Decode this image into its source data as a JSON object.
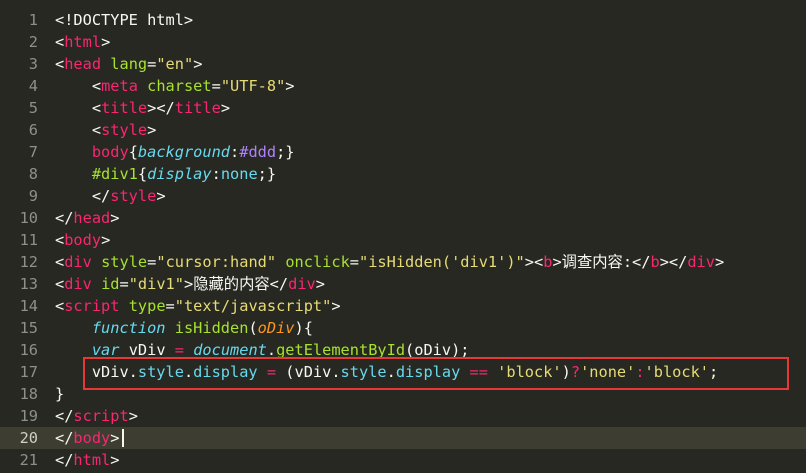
{
  "editor": {
    "theme_colors": {
      "background": "#272822",
      "tag": "#f92672",
      "attribute": "#a6e22e",
      "string": "#e6db74",
      "keyword": "#66d9ef",
      "number": "#ae81ff",
      "parameter": "#fd971f",
      "highlight_box": "#e53935"
    },
    "active_line": 20,
    "lines": [
      {
        "n": "1",
        "tokens": [
          [
            "p",
            "<!DOCTYPE html>"
          ]
        ]
      },
      {
        "n": "2",
        "tokens": [
          [
            "p",
            "<"
          ],
          [
            "t",
            "html"
          ],
          [
            "p",
            ">"
          ]
        ]
      },
      {
        "n": "3",
        "tokens": [
          [
            "p",
            "<"
          ],
          [
            "t",
            "head"
          ],
          [
            "p",
            " "
          ],
          [
            "a",
            "lang"
          ],
          [
            "p",
            "="
          ],
          [
            "s",
            "\"en\""
          ],
          [
            "p",
            ">"
          ]
        ]
      },
      {
        "n": "4",
        "tokens": [
          [
            "p",
            "    <"
          ],
          [
            "t",
            "meta"
          ],
          [
            "p",
            " "
          ],
          [
            "a",
            "charset"
          ],
          [
            "p",
            "="
          ],
          [
            "s",
            "\"UTF-8\""
          ],
          [
            "p",
            ">"
          ]
        ]
      },
      {
        "n": "5",
        "tokens": [
          [
            "p",
            "    <"
          ],
          [
            "t",
            "title"
          ],
          [
            "p",
            "></"
          ],
          [
            "t",
            "title"
          ],
          [
            "p",
            ">"
          ]
        ]
      },
      {
        "n": "6",
        "tokens": [
          [
            "p",
            "    <"
          ],
          [
            "t",
            "style"
          ],
          [
            "p",
            ">"
          ]
        ]
      },
      {
        "n": "7",
        "tokens": [
          [
            "p",
            "    "
          ],
          [
            "t",
            "body"
          ],
          [
            "p",
            "{"
          ],
          [
            "css-prop",
            "background"
          ],
          [
            "p",
            ":"
          ],
          [
            "num",
            "#ddd"
          ],
          [
            "p",
            ";}"
          ]
        ]
      },
      {
        "n": "8",
        "tokens": [
          [
            "p",
            "    "
          ],
          [
            "sel",
            "#div1"
          ],
          [
            "p",
            "{"
          ],
          [
            "css-prop",
            "display"
          ],
          [
            "p",
            ":"
          ],
          [
            "prop",
            "none"
          ],
          [
            "p",
            ";}"
          ]
        ]
      },
      {
        "n": "9",
        "tokens": [
          [
            "p",
            "    </"
          ],
          [
            "t",
            "style"
          ],
          [
            "p",
            ">"
          ]
        ]
      },
      {
        "n": "10",
        "tokens": [
          [
            "p",
            "</"
          ],
          [
            "t",
            "head"
          ],
          [
            "p",
            ">"
          ]
        ]
      },
      {
        "n": "11",
        "tokens": [
          [
            "p",
            "<"
          ],
          [
            "t",
            "body"
          ],
          [
            "p",
            ">"
          ]
        ]
      },
      {
        "n": "12",
        "tokens": [
          [
            "p",
            "<"
          ],
          [
            "t",
            "div"
          ],
          [
            "p",
            " "
          ],
          [
            "a",
            "style"
          ],
          [
            "p",
            "="
          ],
          [
            "s",
            "\"cursor:hand\""
          ],
          [
            "p",
            " "
          ],
          [
            "a",
            "onclick"
          ],
          [
            "p",
            "="
          ],
          [
            "s",
            "\"isHidden('div1')\""
          ],
          [
            "p",
            ">"
          ],
          [
            "p",
            "<"
          ],
          [
            "t",
            "b"
          ],
          [
            "p",
            ">调查内容:</"
          ],
          [
            "t",
            "b"
          ],
          [
            "p",
            "></"
          ],
          [
            "t",
            "div"
          ],
          [
            "p",
            ">"
          ]
        ]
      },
      {
        "n": "13",
        "tokens": [
          [
            "p",
            "<"
          ],
          [
            "t",
            "div"
          ],
          [
            "p",
            " "
          ],
          [
            "a",
            "id"
          ],
          [
            "p",
            "="
          ],
          [
            "s",
            "\"div1\""
          ],
          [
            "p",
            ">隐藏的内容</"
          ],
          [
            "t",
            "div"
          ],
          [
            "p",
            ">"
          ]
        ]
      },
      {
        "n": "14",
        "tokens": [
          [
            "p",
            "<"
          ],
          [
            "t",
            "script"
          ],
          [
            "p",
            " "
          ],
          [
            "a",
            "type"
          ],
          [
            "p",
            "="
          ],
          [
            "s",
            "\"text/javascript\""
          ],
          [
            "p",
            ">"
          ]
        ]
      },
      {
        "n": "15",
        "tokens": [
          [
            "p",
            "    "
          ],
          [
            "kw",
            "function"
          ],
          [
            "p",
            " "
          ],
          [
            "a",
            "isHidden"
          ],
          [
            "p",
            "("
          ],
          [
            "param",
            "oDiv"
          ],
          [
            "p",
            "){"
          ]
        ]
      },
      {
        "n": "16",
        "tokens": [
          [
            "p",
            "    "
          ],
          [
            "kw",
            "var"
          ],
          [
            "p",
            " vDiv "
          ],
          [
            "t",
            "="
          ],
          [
            "p",
            " "
          ],
          [
            "kw",
            "document"
          ],
          [
            "p",
            "."
          ],
          [
            "a",
            "getElementById"
          ],
          [
            "p",
            "(oDiv);"
          ]
        ]
      },
      {
        "n": "17",
        "tokens": [
          [
            "p",
            "    vDiv."
          ],
          [
            "prop",
            "style"
          ],
          [
            "p",
            "."
          ],
          [
            "prop",
            "display"
          ],
          [
            "p",
            " "
          ],
          [
            "t",
            "="
          ],
          [
            "p",
            " (vDiv."
          ],
          [
            "prop",
            "style"
          ],
          [
            "p",
            "."
          ],
          [
            "prop",
            "display"
          ],
          [
            "p",
            " "
          ],
          [
            "t",
            "=="
          ],
          [
            "p",
            " "
          ],
          [
            "s",
            "'block'"
          ],
          [
            "p",
            ")"
          ],
          [
            "t",
            "?"
          ],
          [
            "s",
            "'none'"
          ],
          [
            "t",
            ":"
          ],
          [
            "s",
            "'block'"
          ],
          [
            "p",
            ";"
          ]
        ]
      },
      {
        "n": "18",
        "tokens": [
          [
            "p",
            "}"
          ]
        ]
      },
      {
        "n": "19",
        "tokens": [
          [
            "p",
            "</"
          ],
          [
            "t",
            "script"
          ],
          [
            "p",
            ">"
          ]
        ]
      },
      {
        "n": "20",
        "tokens": [
          [
            "p",
            "</"
          ],
          [
            "t",
            "body"
          ],
          [
            "p",
            ">"
          ]
        ]
      },
      {
        "n": "21",
        "tokens": [
          [
            "p",
            "</"
          ],
          [
            "t",
            "html"
          ],
          [
            "p",
            ">"
          ]
        ]
      }
    ]
  }
}
